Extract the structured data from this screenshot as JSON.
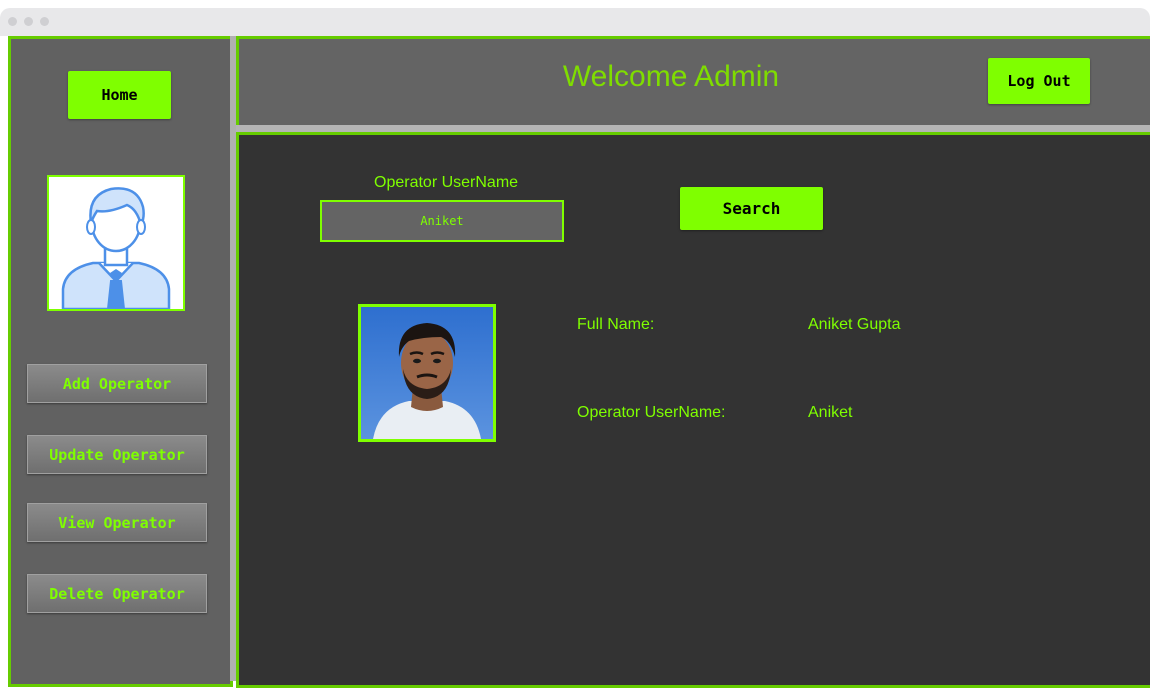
{
  "window": {
    "traffic_lights": [
      "close",
      "minimize",
      "zoom"
    ]
  },
  "sidebar": {
    "home_label": "Home",
    "avatar_icon": "user-avatar-icon",
    "items": [
      {
        "label": "Add Operator"
      },
      {
        "label": "Update Operator"
      },
      {
        "label": "View Operator"
      },
      {
        "label": "Delete Operator"
      }
    ]
  },
  "header": {
    "title": "Welcome Admin",
    "logout_label": "Log Out"
  },
  "search": {
    "label": "Operator UserName",
    "value": "Aniket",
    "button_label": "Search"
  },
  "result": {
    "full_name_label": "Full Name:",
    "full_name_value": "Aniket Gupta",
    "username_label": "Operator UserName:",
    "username_value": "Aniket"
  },
  "colors": {
    "accent": "#7fff00",
    "sidebar_bg": "#616161",
    "main_bg": "#333333"
  }
}
